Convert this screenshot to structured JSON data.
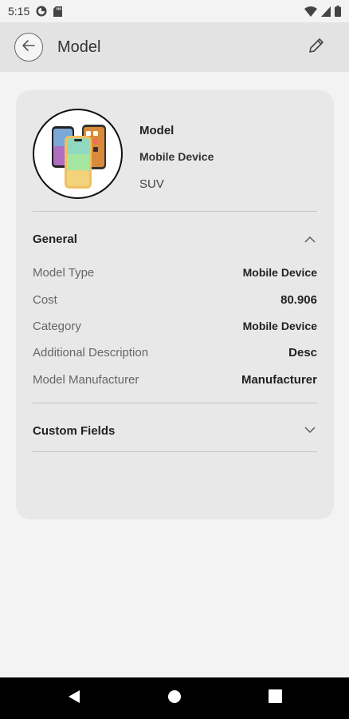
{
  "status_bar": {
    "time": "5:15"
  },
  "app_bar": {
    "title": "Model"
  },
  "header": {
    "title": "Model",
    "subtitle": "Mobile Device",
    "tag": "SUV"
  },
  "general": {
    "title": "General",
    "rows": [
      {
        "label": "Model Type",
        "value": "Mobile Device"
      },
      {
        "label": "Cost",
        "value": "80.906"
      },
      {
        "label": "Category",
        "value": "Mobile Device"
      },
      {
        "label": "Additional Description",
        "value": "Desc"
      },
      {
        "label": "Model Manufacturer",
        "value": "Manufacturer"
      }
    ]
  },
  "custom_fields": {
    "title": "Custom Fields"
  },
  "icons": {
    "back": "arrow-left-icon",
    "edit": "pencil-icon",
    "general_toggle": "chevron-up-icon",
    "custom_toggle": "chevron-down-icon",
    "nav_back": "triangle-back-icon",
    "nav_home": "circle-home-icon",
    "nav_recents": "square-recents-icon"
  },
  "colors": {
    "background": "#f3f3f3",
    "app_bar": "#e3e3e3",
    "card": "#e8e8e8",
    "nav_bar": "#000000"
  }
}
